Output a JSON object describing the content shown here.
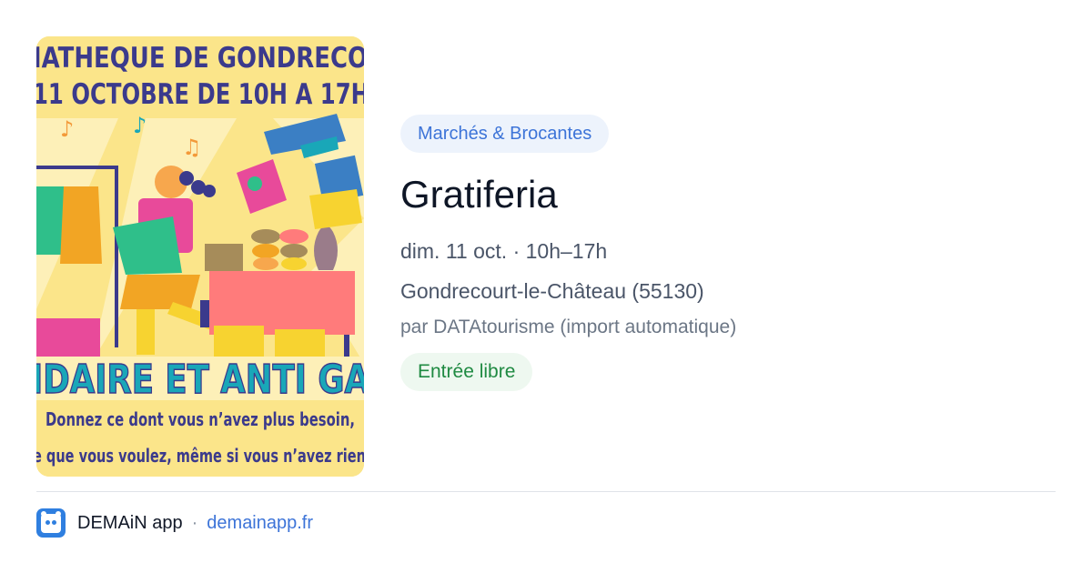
{
  "poster": {
    "line1": "IATHEQUE DE GONDRECO",
    "line2": "11 OCTOBRE DE 10H A 17H",
    "banner": "IDAIRE ET ANTI GA",
    "tagline1": "Donnez ce dont vous n’avez plus besoin,",
    "tagline2": "e que vous voulez, même si vous n’avez rien"
  },
  "event": {
    "category": "Marchés & Brocantes",
    "title": "Gratiferia",
    "date": "dim. 11 oct. · 10h–17h",
    "location": "Gondrecourt-le-Château (55130)",
    "source": "par DATAtourisme (import automatique)",
    "price": "Entrée libre"
  },
  "footer": {
    "app_name": "DEMAiN app",
    "separator": "·",
    "url": "demainapp.fr"
  },
  "colors": {
    "accent": "#3d74d8",
    "price_green": "#1f8a42",
    "poster_bg": "#fbe58a",
    "poster_title": "#3b3a8c",
    "poster_banner": "#19a7b8"
  }
}
